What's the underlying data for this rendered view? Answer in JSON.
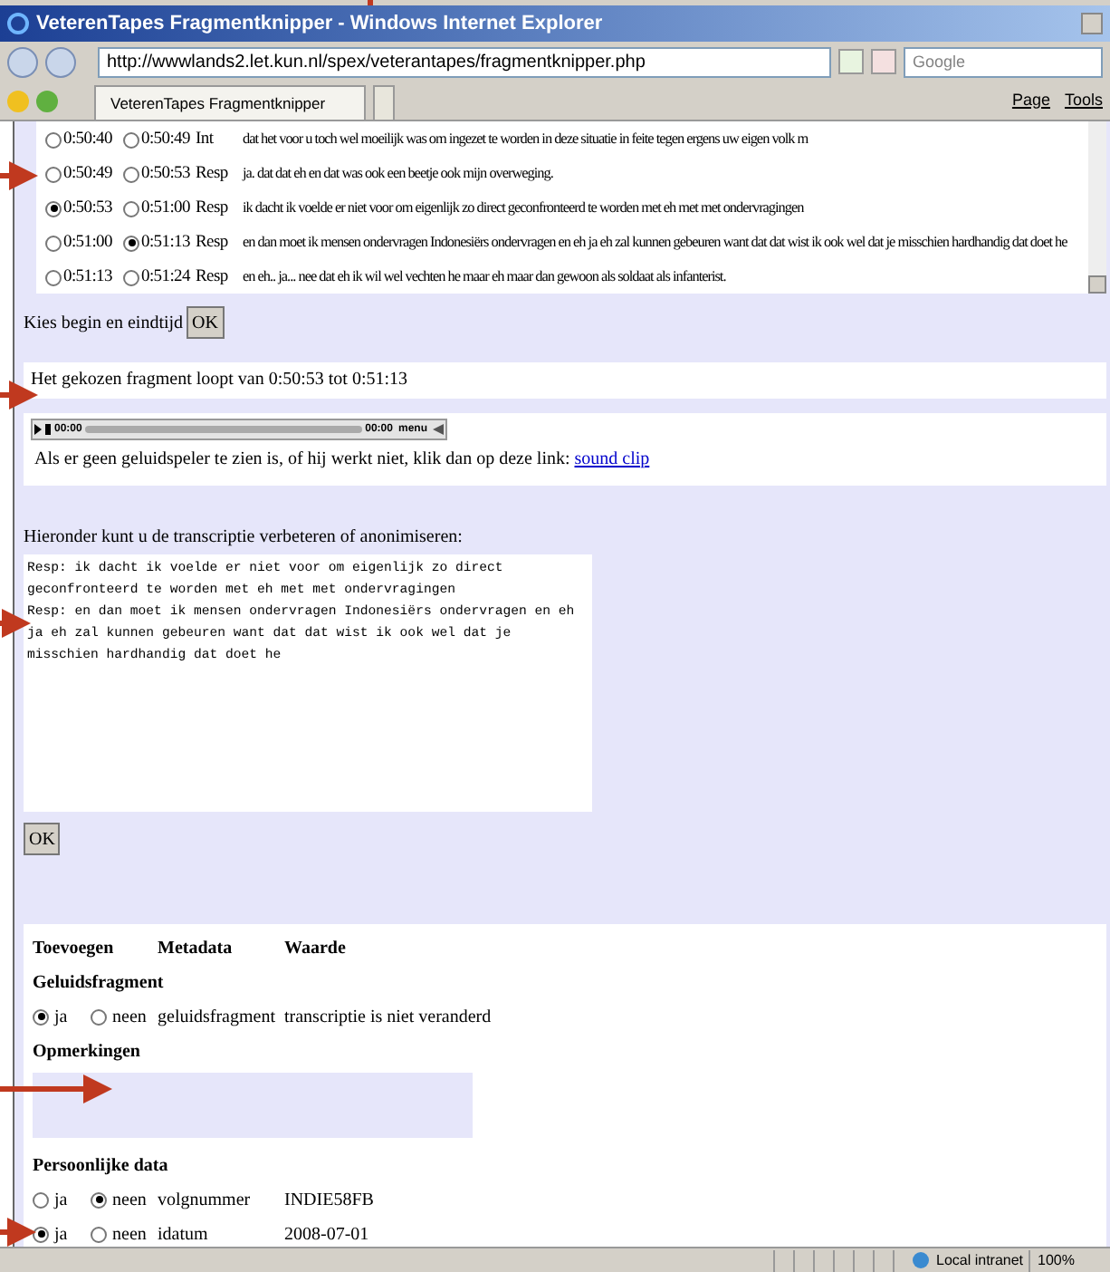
{
  "window": {
    "title": "VeterenTapes Fragmentknipper - Windows Internet Explorer"
  },
  "address_bar": {
    "url": "http://wwwlands2.let.kun.nl/spex/veterantapes/fragmentknipper.php"
  },
  "search": {
    "placeholder": "Google"
  },
  "tab": {
    "label": "VeterenTapes Fragmentknipper"
  },
  "command_bar": [
    {
      "label": "Page"
    },
    {
      "label": "Tools"
    }
  ],
  "transcript": [
    {
      "begin": "0:50:40",
      "begin_selected": false,
      "end": "0:50:49",
      "end_selected": false,
      "speaker": "Int",
      "text": "dat het voor u toch wel moeilijk was om ingezet te worden in deze situatie in feite tegen ergens uw eigen volk m"
    },
    {
      "begin": "0:50:49",
      "begin_selected": false,
      "end": "0:50:53",
      "end_selected": false,
      "speaker": "Resp",
      "text": "ja. dat dat eh en dat was ook een beetje ook mijn overweging."
    },
    {
      "begin": "0:50:53",
      "begin_selected": true,
      "end": "0:51:00",
      "end_selected": false,
      "speaker": "Resp",
      "text": "ik dacht ik voelde er niet voor om eigenlijk zo direct geconfronteerd te worden met eh met met ondervragingen"
    },
    {
      "begin": "0:51:00",
      "begin_selected": false,
      "end": "0:51:13",
      "end_selected": true,
      "speaker": "Resp",
      "text": "en dan moet ik mensen ondervragen Indonesiërs ondervragen en eh ja eh zal kunnen gebeuren want dat dat wist ik ook wel dat je misschien hardhandig dat doet he"
    },
    {
      "begin": "0:51:13",
      "begin_selected": false,
      "end": "0:51:24",
      "end_selected": false,
      "speaker": "Resp",
      "text": "en eh.. ja... nee dat eh ik wil wel vechten he maar eh maar dan gewoon als soldaat als infanterist."
    }
  ],
  "choose_label": "Kies begin en eindtijd",
  "choose_button": "OK",
  "fragment_info": "Het gekozen fragment loopt van 0:50:53 tot 0:51:13",
  "player": {
    "time_start": "00:00",
    "time_end": "00:00",
    "menu": "menu"
  },
  "player_note": "Als er geen geluidspeler te zien is, of hij werkt niet, klik dan op deze link:",
  "player_link": "sound clip",
  "edit_label": "Hieronder kunt u de transcriptie verbeteren of anonimiseren:",
  "transcript_edit": "Resp: ik dacht ik voelde er niet voor om eigenlijk zo direct geconfronteerd te worden met eh met met ondervragingen\nResp: en dan moet ik mensen ondervragen Indonesiërs ondervragen en eh ja eh zal kunnen gebeuren want dat dat wist ik ook wel dat je misschien hardhandig dat doet he",
  "edit_button": "OK",
  "metadata": {
    "columns": [
      "Toevoegen",
      "Metadata",
      "Waarde"
    ],
    "sections": [
      {
        "title": "Geluidsfragment",
        "rows": [
          {
            "yes": "ja",
            "no": "neen",
            "yes_selected": true,
            "key": "geluidsfragment",
            "value": "transcriptie is niet veranderd"
          }
        ]
      },
      {
        "title": "Opmerkingen"
      },
      {
        "title": "Persoonlijke data",
        "rows": [
          {
            "yes": "ja",
            "no": "neen",
            "yes_selected": false,
            "key": "volgnummer",
            "value": "INDIE58FB"
          },
          {
            "yes": "ja",
            "no": "neen",
            "yes_selected": true,
            "key": "idatum",
            "value": "2008-07-01"
          }
        ]
      }
    ]
  },
  "status_bar": {
    "zone": "Local intranet",
    "zoom": "100%"
  }
}
